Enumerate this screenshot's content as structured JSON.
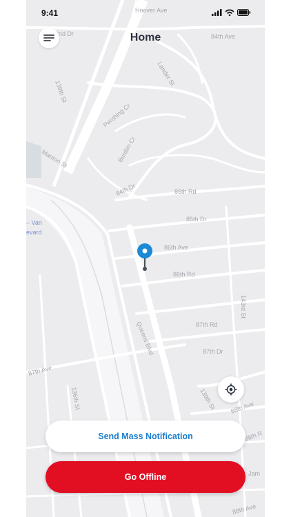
{
  "status_bar": {
    "time": "9:41"
  },
  "header": {
    "title": "Home"
  },
  "map": {
    "streets": [
      "Hoover Ave",
      "2nd Dr",
      "84th Ave",
      "Lander St",
      "139th St",
      "Pershing Cr",
      "Burden Cr",
      "Manton St",
      "84th Dr",
      "85th Rd",
      "85th Dr",
      "86th Ave",
      "86th Rd",
      "143rd St",
      "87th Rd",
      "87th Dr",
      "Queens Blvd",
      "87th Ave",
      "136th St",
      "139th St",
      "88th Ave",
      "88th R",
      "Jam",
      "88th Ave",
      "– Van",
      "evard"
    ],
    "icons": {
      "menu": "menu-icon",
      "pin": "location-pin-icon",
      "locate": "crosshair-icon"
    },
    "colors": {
      "pin": "#1a8ad6",
      "background": "#ececef",
      "roads": "#ffffff"
    }
  },
  "actions": {
    "notify_label": "Send Mass Notification",
    "offline_label": "Go Offline"
  },
  "colors": {
    "primary_blue": "#1b7fd0",
    "offline_red": "#e20f23"
  }
}
